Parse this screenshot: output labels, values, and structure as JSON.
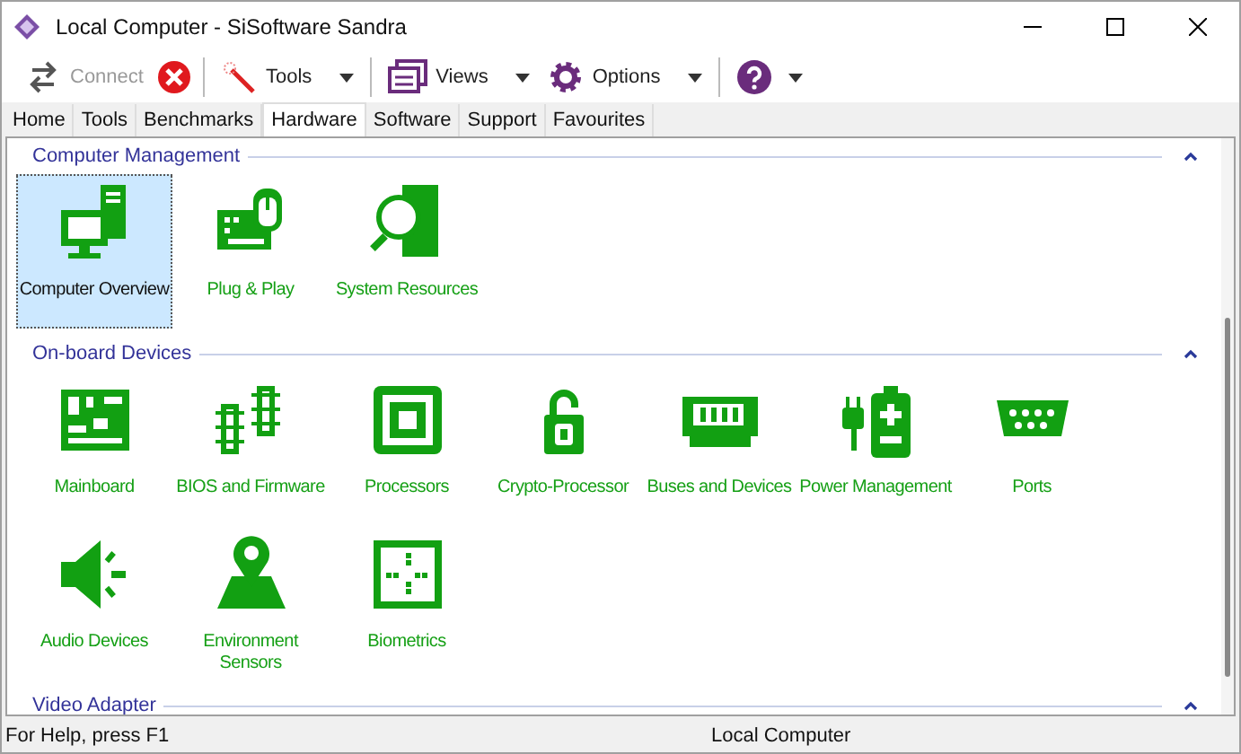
{
  "window": {
    "title": "Local Computer - SiSoftware Sandra"
  },
  "toolbar": [
    {
      "kind": "button",
      "label": "Connect",
      "disabled": true
    },
    {
      "kind": "icon"
    },
    {
      "kind": "menu",
      "label": "Tools"
    },
    {
      "kind": "menu",
      "label": "Views"
    },
    {
      "kind": "menu",
      "label": "Options"
    },
    {
      "kind": "menu"
    }
  ],
  "tabs": [
    {
      "label": "Home",
      "selected": false
    },
    {
      "label": "Tools",
      "selected": false
    },
    {
      "label": "Benchmarks",
      "selected": false
    },
    {
      "label": "Hardware",
      "selected": true
    },
    {
      "label": "Software",
      "selected": false
    },
    {
      "label": "Support",
      "selected": false
    },
    {
      "label": "Favourites",
      "selected": false
    }
  ],
  "sections": [
    {
      "title": "Computer Management",
      "expanded": true,
      "items": [
        {
          "label": "Computer Overview",
          "selected": true
        },
        {
          "label": "Plug & Play",
          "selected": false
        },
        {
          "label": "System Resources",
          "selected": false
        }
      ]
    },
    {
      "title": "On-board Devices",
      "expanded": true,
      "items": [
        {
          "label": "Mainboard",
          "selected": false
        },
        {
          "label": "BIOS and Firmware",
          "selected": false
        },
        {
          "label": "Processors",
          "selected": false
        },
        {
          "label": "Crypto-Processor",
          "selected": false
        },
        {
          "label": "Buses and Devices",
          "selected": false
        },
        {
          "label": "Power Management",
          "selected": false
        },
        {
          "label": "Ports",
          "selected": false
        },
        {
          "label": "Audio Devices",
          "selected": false
        },
        {
          "label": "Environment Sensors",
          "selected": false
        },
        {
          "label": "Biometrics",
          "selected": false
        }
      ]
    },
    {
      "title": "Video Adapter",
      "expanded": true
    }
  ],
  "status_bar": {
    "help": "For Help, press F1",
    "computer": "Local Computer"
  }
}
